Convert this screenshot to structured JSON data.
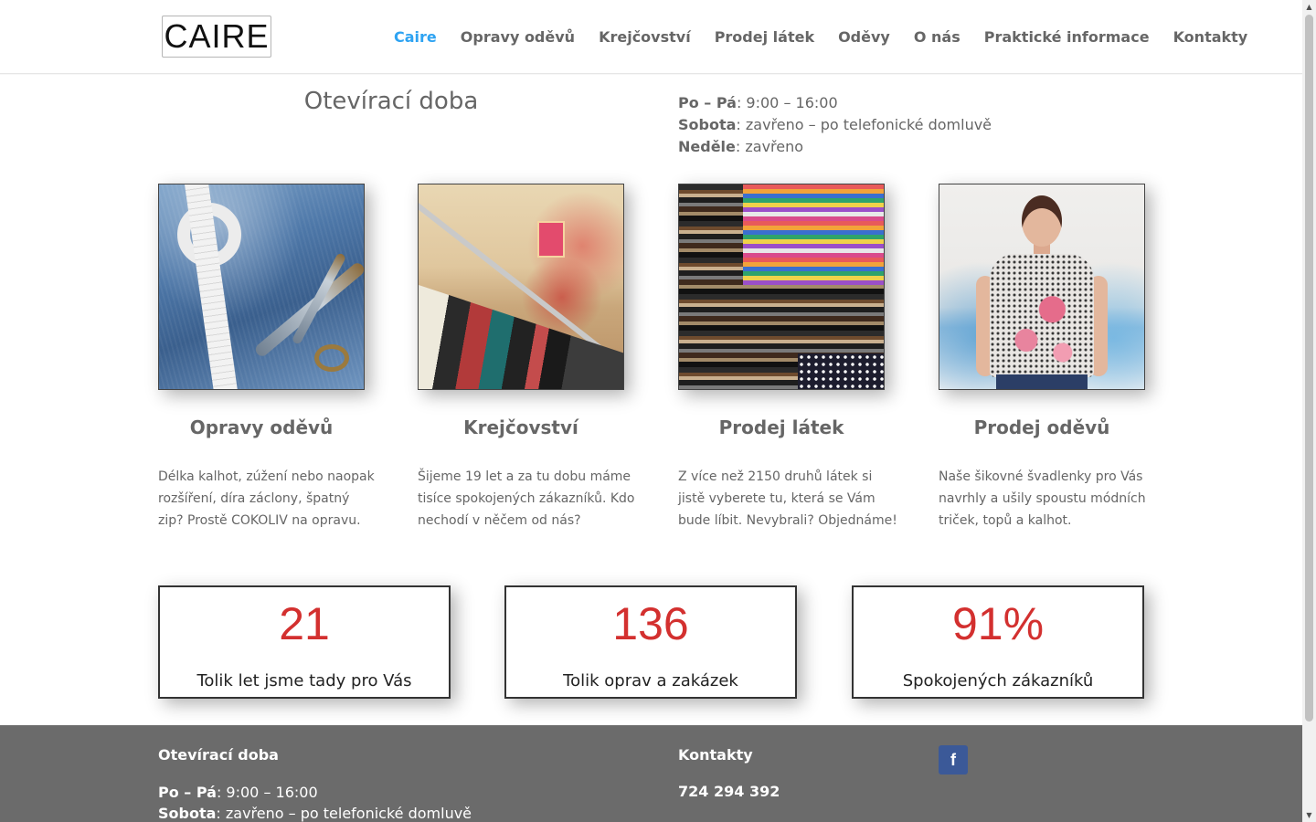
{
  "header": {
    "logo_text": "CAIRE",
    "nav": [
      {
        "label": "Caire",
        "active": true
      },
      {
        "label": "Opravy oděvů",
        "active": false
      },
      {
        "label": "Krejčovství",
        "active": false
      },
      {
        "label": "Prodej látek",
        "active": false
      },
      {
        "label": "Oděvy",
        "active": false
      },
      {
        "label": "O nás",
        "active": false
      },
      {
        "label": "Praktické informace",
        "active": false
      },
      {
        "label": "Kontakty",
        "active": false
      }
    ]
  },
  "hours": {
    "title": "Otevírací doba",
    "rows": [
      {
        "day": "Po – Pá",
        "value": ": 9:00 – 16:00"
      },
      {
        "day": "Sobota",
        "value": ": zavřeno – po telefonické domluvě"
      },
      {
        "day": "Neděle",
        "value": ": zavřeno"
      }
    ]
  },
  "services": [
    {
      "title": "Opravy oděvů",
      "desc": "Délka kalhot, zúžení nebo naopak rozšíření, díra záclony, špatný zip? Prostě COKOLIV na opravu.",
      "image": "jeans-scissors-tape-photo"
    },
    {
      "title": "Krejčovství",
      "desc": "Šijeme 19 let a za tu dobu máme tisíce spokojených zákazníků. Kdo nechodí v něčem od nás?",
      "image": "clothes-rack-photo"
    },
    {
      "title": "Prodej látek",
      "desc": "Z více než 2150 druhů látek si jistě vyberete tu, která se Vám bude líbit. Nevybrali? Objednáme!",
      "image": "fabric-stacks-photo"
    },
    {
      "title": "Prodej oděvů",
      "desc": "Naše šikovné švadlenky pro Vás navrhly a ušily spoustu módních triček, topů a kalhot.",
      "image": "woman-floral-top-photo"
    }
  ],
  "stats": [
    {
      "number": "21",
      "label": "Tolik let jsme tady pro Vás"
    },
    {
      "number": "136",
      "label": "Tolik oprav a zakázek"
    },
    {
      "number": "91%",
      "label": "Spokojených zákazníků"
    }
  ],
  "footer": {
    "hours_title": "Otevírací doba",
    "hours": [
      {
        "day": "Po – Pá",
        "value": ": 9:00 – 16:00"
      },
      {
        "day": "Sobota",
        "value": ": zavřeno – po telefonické domluvě"
      }
    ],
    "contacts_title": "Kontakty",
    "phone": "724 294 392",
    "facebook_glyph": "f"
  },
  "colors": {
    "accent": "#2ea3f2",
    "stat_number": "#d3302f",
    "footer_bg": "#6b6b6b",
    "facebook": "#3b5998"
  }
}
